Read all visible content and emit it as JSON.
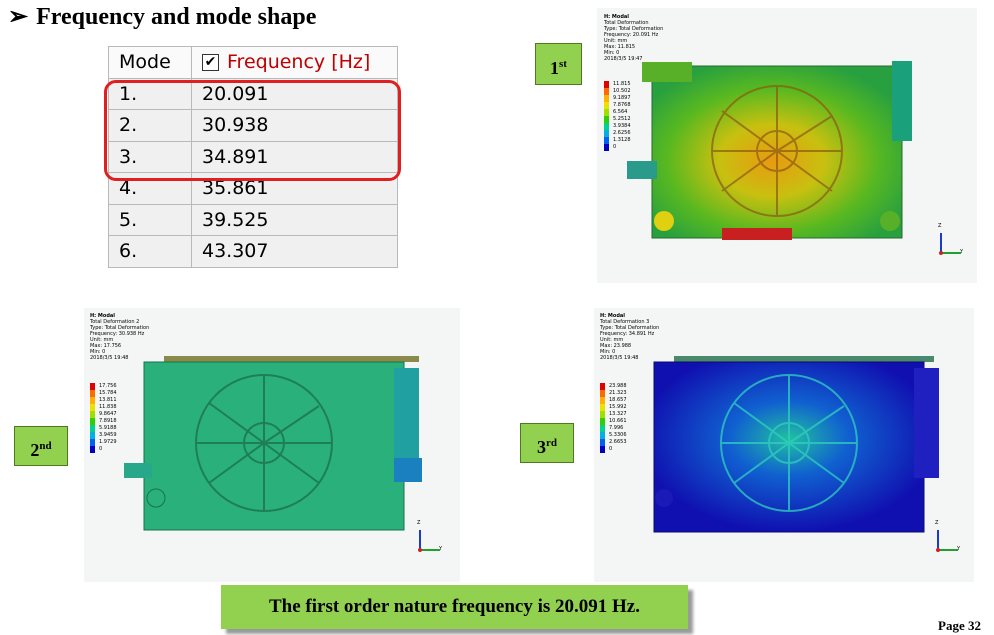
{
  "title": {
    "bullet": "➢",
    "text": "Frequency and mode shape"
  },
  "table": {
    "mode_header": "Mode",
    "checkbox": "✔",
    "frequency_header": "Frequency [Hz]",
    "rows": [
      {
        "mode": "1.",
        "freq": "20.091"
      },
      {
        "mode": "2.",
        "freq": "30.938"
      },
      {
        "mode": "3.",
        "freq": "34.891"
      },
      {
        "mode": "4.",
        "freq": "35.861"
      },
      {
        "mode": "5.",
        "freq": "39.525"
      },
      {
        "mode": "6.",
        "freq": "43.307"
      }
    ]
  },
  "modes": [
    {
      "badge_num": "1",
      "badge_sup": "st",
      "header": [
        "H: Modal",
        "Total Deformation",
        "Type: Total Deformation",
        "Frequency: 20.091 Hz",
        "Unit: mm",
        "Max: 11.815",
        "Min: 0",
        "2018/3/5 19:47"
      ],
      "scale": [
        "11.815",
        "10.502",
        "9.1897",
        "7.8768",
        "6.564",
        "5.2512",
        "3.9384",
        "2.6256",
        "1.3128",
        "0"
      ]
    },
    {
      "badge_num": "2",
      "badge_sup": "nd",
      "header": [
        "H: Modal",
        "Total Deformation 2",
        "Type: Total Deformation",
        "Frequency: 30.938 Hz",
        "Unit: mm",
        "Max: 17.756",
        "Min: 0",
        "2018/3/5 19:48"
      ],
      "scale": [
        "17.756",
        "15.784",
        "13.811",
        "11.838",
        "9.8647",
        "7.8918",
        "5.9188",
        "3.9459",
        "1.9729",
        "0"
      ]
    },
    {
      "badge_num": "3",
      "badge_sup": "rd",
      "header": [
        "H: Modal",
        "Total Deformation 3",
        "Type: Total Deformation",
        "Frequency: 34.891 Hz",
        "Unit: mm",
        "Max: 23.988",
        "Min: 0",
        "2018/3/5 19:48"
      ],
      "scale": [
        "23.988",
        "21.323",
        "18.657",
        "15.992",
        "13.327",
        "10.661",
        "7.996",
        "5.3306",
        "2.6653",
        "0"
      ]
    }
  ],
  "scale_colors": [
    "#e00000",
    "#ff6a00",
    "#ffb000",
    "#f0e000",
    "#a0e000",
    "#30d000",
    "#00d090",
    "#00b0e0",
    "#0060f0",
    "#0000c0"
  ],
  "axis": {
    "z": "Z",
    "y": "Y"
  },
  "conclusion": "The first order nature frequency is 20.091 Hz.",
  "page": "Page 32"
}
